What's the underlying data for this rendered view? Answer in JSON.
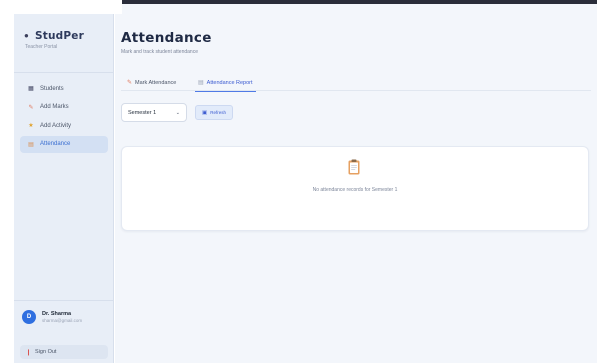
{
  "brand": {
    "title": "StudPer",
    "subtitle": "Teacher Portal"
  },
  "sidebar": {
    "items": [
      {
        "label": "Students",
        "icon": "grid-icon"
      },
      {
        "label": "Add Marks",
        "icon": "pencil-icon"
      },
      {
        "label": "Add Activity",
        "icon": "trophy-icon"
      },
      {
        "label": "Attendance",
        "icon": "clipboard-icon",
        "active": true
      }
    ]
  },
  "user": {
    "initial": "D",
    "name": "Dr. Sharma",
    "email": "sharma@gmail.com"
  },
  "signout": {
    "label": "Sign Out"
  },
  "page": {
    "title": "Attendance",
    "subtitle": "Mark and track student attendance"
  },
  "tabs": [
    {
      "label": "Mark Attendance",
      "icon": "pencil-icon"
    },
    {
      "label": "Attendance Report",
      "icon": "clipboard-icon",
      "active": true
    }
  ],
  "controls": {
    "semester_value": "Semester 1",
    "refresh_label": "Refresh"
  },
  "empty_state": {
    "message": "No attendance records for Semester 1"
  },
  "colors": {
    "accent": "#4f7ae6",
    "sidebar_bg": "#e8eef7",
    "main_bg": "#f3f6fb",
    "avatar": "#2f6fe0"
  }
}
